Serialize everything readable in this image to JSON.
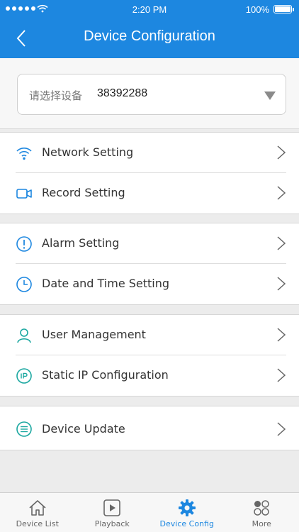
{
  "status_bar": {
    "time": "2:20 PM",
    "battery": "100%"
  },
  "header": {
    "title": "Device Configuration"
  },
  "device_selector": {
    "placeholder": "请选择设备",
    "value": "38392288"
  },
  "groups": [
    {
      "items": [
        {
          "label": "Network Setting",
          "icon": "wifi-icon"
        },
        {
          "label": "Record Setting",
          "icon": "video-camera-icon"
        }
      ]
    },
    {
      "items": [
        {
          "label": "Alarm Setting",
          "icon": "alert-icon"
        },
        {
          "label": "Date and Time Setting",
          "icon": "clock-icon"
        }
      ]
    },
    {
      "items": [
        {
          "label": "User Management",
          "icon": "user-icon"
        },
        {
          "label": "Static IP Configuration",
          "icon": "ip-icon"
        }
      ]
    },
    {
      "items": [
        {
          "label": "Device Update",
          "icon": "update-icon"
        }
      ]
    }
  ],
  "tabbar": {
    "active_color": "#1d87e0",
    "tabs": [
      {
        "label": "Device List",
        "icon": "home-icon"
      },
      {
        "label": "Playback",
        "icon": "play-icon"
      },
      {
        "label": "Device Config",
        "icon": "gear-icon",
        "active": true
      },
      {
        "label": "More",
        "icon": "more-icon"
      }
    ]
  }
}
